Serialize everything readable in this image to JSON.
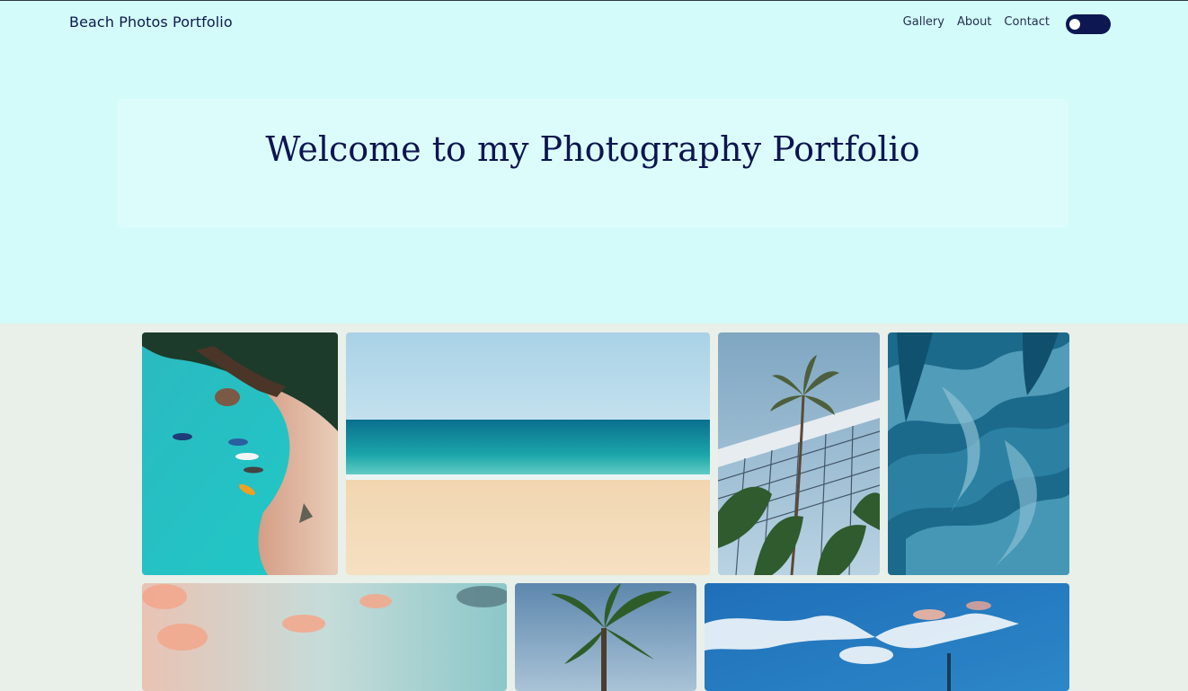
{
  "header": {
    "brand": "Beach Photos Portfolio",
    "nav": [
      "Gallery",
      "About",
      "Contact"
    ],
    "theme_toggle_icon": "toggle-switch"
  },
  "hero": {
    "title": "Welcome to my Photography Portfolio"
  },
  "gallery": {
    "photos": [
      {
        "subject": "aerial beach with boats"
      },
      {
        "subject": "sandy beach and turquoise sea"
      },
      {
        "subject": "palm trees behind volleyball net"
      },
      {
        "subject": "blue abstract paint texture"
      },
      {
        "subject": "pink sunset sky"
      },
      {
        "subject": "palm tree against sky"
      },
      {
        "subject": "blue sky with clouds"
      }
    ]
  },
  "colors": {
    "hero_bg": "#d3fbfa",
    "page_bg": "#e9efe9",
    "text_dark": "#0b1650",
    "toggle_bg": "#0d1751"
  }
}
